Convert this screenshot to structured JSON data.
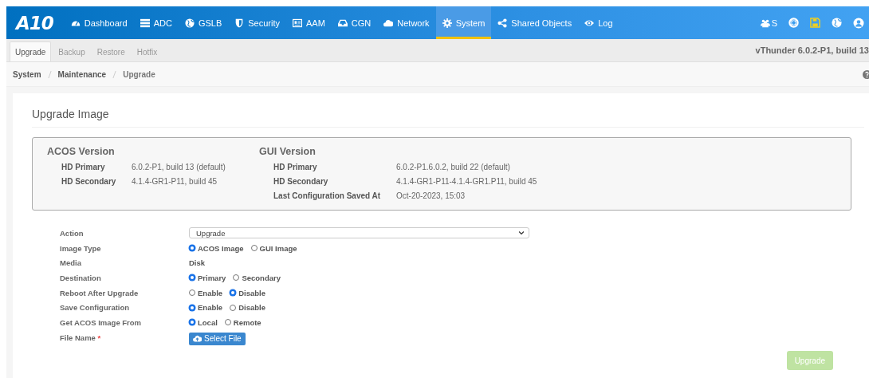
{
  "navbar": {
    "logo": "A10",
    "items": [
      {
        "label": "Dashboard",
        "selected": false
      },
      {
        "label": "ADC",
        "selected": false
      },
      {
        "label": "GSLB",
        "selected": false
      },
      {
        "label": "Security",
        "selected": false
      },
      {
        "label": "AAM",
        "selected": false
      },
      {
        "label": "CGN",
        "selected": false
      },
      {
        "label": "Network",
        "selected": false
      },
      {
        "label": "System",
        "selected": true
      },
      {
        "label": "Shared Objects",
        "selected": false
      },
      {
        "label": "Log",
        "selected": false
      }
    ],
    "user_label": "S"
  },
  "subtabs": [
    {
      "label": "Upgrade",
      "selected": true
    },
    {
      "label": "Backup",
      "selected": false
    },
    {
      "label": "Restore",
      "selected": false
    },
    {
      "label": "Hotfix",
      "selected": false
    }
  ],
  "version_text": "vThunder 6.0.2-P1, build 13",
  "breadcrumb": [
    "System",
    "Maintenance",
    "Upgrade"
  ],
  "panel": {
    "title": "Upgrade Image",
    "versions": [
      {
        "title": "ACOS Version",
        "rows": [
          {
            "label": "HD Primary",
            "value": "6.0.2-P1, build 13 (default)"
          },
          {
            "label": "HD Secondary",
            "value": "4.1.4-GR1-P11, build 45"
          }
        ]
      },
      {
        "title": "GUI Version",
        "rows": [
          {
            "label": "HD Primary",
            "value": "6.0.2-P1.6.0.2, build 22 (default)"
          },
          {
            "label": "HD Secondary",
            "value": "4.1.4-GR1-P11-4.1.4-GR1.P11, build 45"
          },
          {
            "label": "Last Configuration Saved At",
            "value": "Oct-20-2023, 15:03"
          }
        ]
      }
    ],
    "form": [
      {
        "kind": "select",
        "label": "Action",
        "value": "Upgrade"
      },
      {
        "kind": "radio",
        "label": "Image Type",
        "options": [
          {
            "label": "ACOS Image",
            "selected": true
          },
          {
            "label": "GUI Image",
            "selected": false
          }
        ]
      },
      {
        "kind": "text",
        "label": "Media",
        "value": "Disk"
      },
      {
        "kind": "radio",
        "label": "Destination",
        "options": [
          {
            "label": "Primary",
            "selected": true
          },
          {
            "label": "Secondary",
            "selected": false
          }
        ]
      },
      {
        "kind": "radio",
        "label": "Reboot After Upgrade",
        "options": [
          {
            "label": "Enable",
            "selected": false
          },
          {
            "label": "Disable",
            "selected": true
          }
        ]
      },
      {
        "kind": "radio",
        "label": "Save Configuration",
        "options": [
          {
            "label": "Enable",
            "selected": true
          },
          {
            "label": "Disable",
            "selected": false
          }
        ]
      },
      {
        "kind": "radio",
        "label": "Get ACOS Image From",
        "options": [
          {
            "label": "Local",
            "selected": true
          },
          {
            "label": "Remote",
            "selected": false
          }
        ]
      },
      {
        "kind": "file",
        "label": "File Name",
        "required_mark": "*",
        "button": "Select File"
      }
    ],
    "submit": {
      "label": "Upgrade",
      "disabled": true
    }
  }
}
